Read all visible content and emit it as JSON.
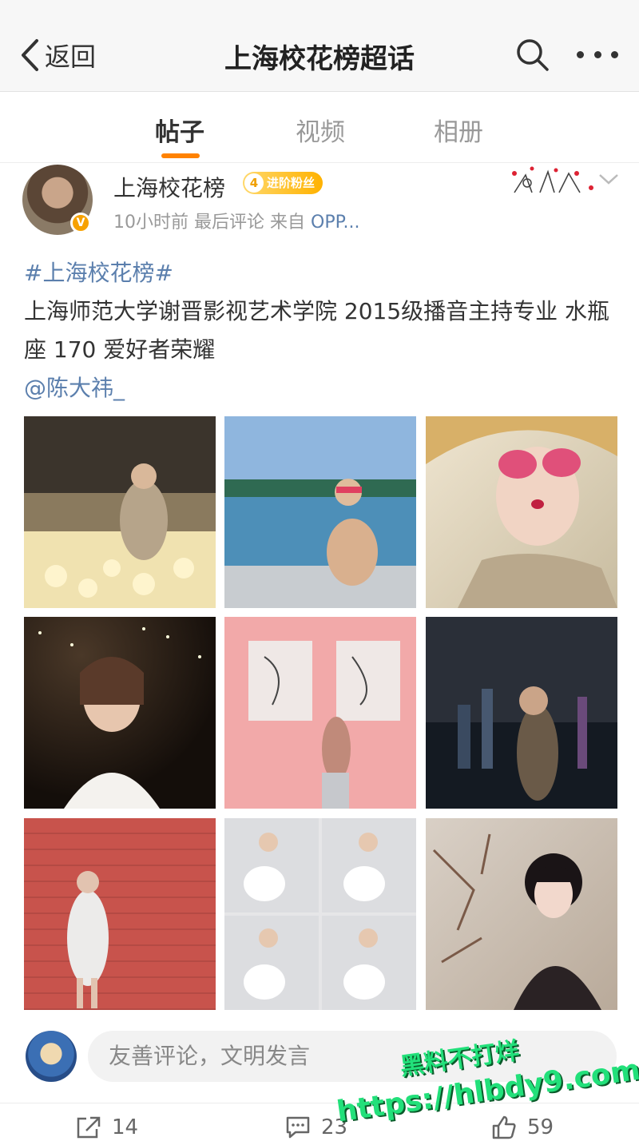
{
  "header": {
    "back_label": "返回",
    "title": "上海校花榜超话"
  },
  "tabs": [
    {
      "label": "帖子"
    },
    {
      "label": "视频"
    },
    {
      "label": "相册"
    }
  ],
  "post": {
    "username": "上海校花榜",
    "fan_badge": {
      "level": "4",
      "label": "进阶粉丝"
    },
    "time": "10小时前",
    "last_comment": "最后评论",
    "source_prefix": "来自",
    "source": "OPP...",
    "hashtag": "#上海校花榜#",
    "body": "上海师范大学谢晋影视艺术学院 2015级播音主持专业 水瓶座 170 爱好者荣耀",
    "mention": "@陈大祎_",
    "images": [
      {
        "id": "photo-1",
        "scene": "ball-pit"
      },
      {
        "id": "photo-2",
        "scene": "pool"
      },
      {
        "id": "photo-3",
        "scene": "straw-hat"
      },
      {
        "id": "photo-4",
        "scene": "night-lights"
      },
      {
        "id": "photo-5",
        "scene": "pink-wall"
      },
      {
        "id": "photo-6",
        "scene": "city-window"
      },
      {
        "id": "photo-7",
        "scene": "red-wall"
      },
      {
        "id": "photo-8",
        "scene": "puppy-collage"
      },
      {
        "id": "photo-9",
        "scene": "branches"
      }
    ]
  },
  "comment_input": {
    "placeholder": "友善评论，文明发言"
  },
  "actions": {
    "share_count": "14",
    "comment_count": "23",
    "like_count": "59"
  },
  "watermark": {
    "line1": "黑料不打烊",
    "line2": "https://hlbdy9.com"
  },
  "colors": {
    "accent": "#ff8200",
    "link": "#5b7fad",
    "watermark": "#22e07a"
  }
}
